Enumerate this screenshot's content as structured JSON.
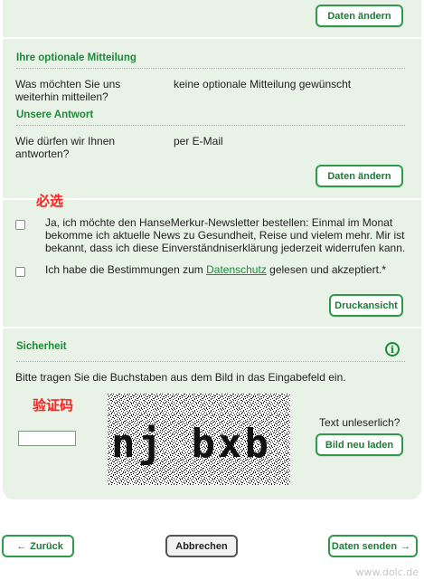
{
  "top_section": {
    "edit_button": "Daten ändern"
  },
  "optional_message": {
    "heading": "Ihre optionale Mitteilung",
    "question_line1": "Was möchten Sie uns",
    "question_line2": "weiterhin mitteilen?",
    "answer": "keine optionale Mitteilung gewünscht"
  },
  "our_answer": {
    "heading": "Unsere Antwort",
    "question_line1": "Wie dürfen wir Ihnen",
    "question_line2": "antworten?",
    "answer": "per E-Mail",
    "edit_button": "Daten ändern"
  },
  "consent": {
    "required_annotation": "必选",
    "newsletter_line1": "Ja, ich möchte den HanseMerkur-Newsletter bestellen: Einmal im Monat",
    "newsletter_line2": "bekomme ich aktuelle News zu Gesundheit, Reise und vielem mehr. Mir ist",
    "newsletter_line3": "bekannt, dass ich diese Einverständniserklärung jederzeit widerrufen kann.",
    "privacy_prefix": "Ich habe die Bestimmungen zum ",
    "privacy_link": "Datenschutz",
    "privacy_suffix": " gelesen und akzeptiert.*",
    "print_button": "Druckansicht"
  },
  "security": {
    "heading": "Sicherheit",
    "instruction": "Bitte tragen Sie die Buchstaben aus dem Bild in das Eingabefeld ein.",
    "captcha_annotation": "验证码",
    "captcha_text": "nj bxb",
    "input_value": "",
    "unreadable_label": "Text unleserlich?",
    "reload_button": "Bild neu laden"
  },
  "navigation": {
    "back_button": "Zurück",
    "cancel_button": "Abbrechen",
    "send_button": "Daten senden"
  },
  "icons": {
    "info": "info-icon",
    "back_arrow": "arrow-left-icon",
    "send_arrow": "arrow-right-icon"
  },
  "watermark": "www.dolc.de",
  "colors": {
    "panel_bg": "#e9f2e6",
    "accent_green": "#1d8a3a",
    "annotation_red": "#ff2020"
  }
}
